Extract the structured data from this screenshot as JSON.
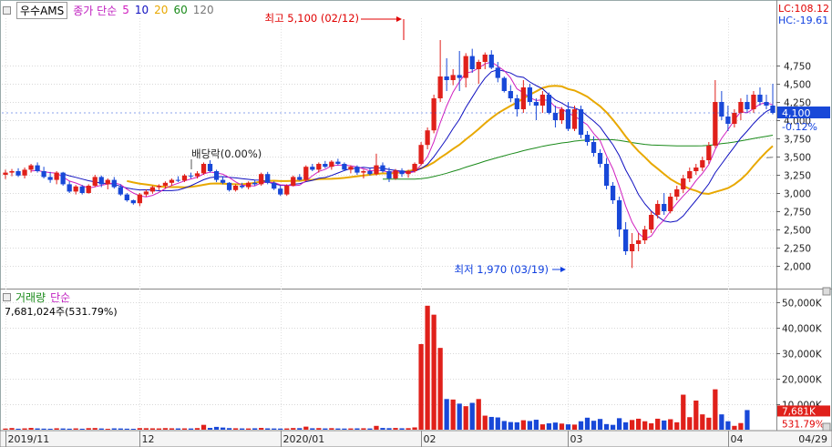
{
  "header": {
    "stock_name": "우수AMS",
    "ma_label": "종가 단순",
    "ma_periods": [
      "5",
      "10",
      "20",
      "60",
      "120"
    ],
    "ma_colors": [
      "#d020c0",
      "#1010c0",
      "#e8a800",
      "#1a8a1a",
      "#777777"
    ]
  },
  "right_info": {
    "lc": "LC:108.12",
    "hc": "HC:-19.61"
  },
  "volume_header": {
    "title": "거래량",
    "ma": "단순",
    "info": "7,681,024주(531.79%)"
  },
  "chart_data": {
    "type": "candlestick",
    "price_axis": {
      "min": 1700,
      "max": 5400,
      "ticks": [
        2000,
        2250,
        2500,
        2750,
        3000,
        3250,
        3500,
        3750,
        4000,
        4250,
        4500,
        4750
      ]
    },
    "price_tick_labels": [
      "2,000",
      "2,250",
      "2,500",
      "2,750",
      "3,000",
      "3,250",
      "3,500",
      "3,750",
      "4,000",
      "4,250",
      "4,500",
      "4,750"
    ],
    "current_price": 4100,
    "current_price_label": "4,100",
    "current_change": "-0.12%",
    "volume_axis": {
      "max": 52000,
      "ticks": [
        10000,
        20000,
        30000,
        40000,
        50000
      ]
    },
    "volume_tick_labels": [
      "10,000K",
      "20,000K",
      "30,000K",
      "40,000K",
      "50,000K"
    ],
    "current_volume_label": "7,681K",
    "current_volume_pct": "531.79%",
    "x_labels": [
      {
        "i": 0,
        "label": "2019/11"
      },
      {
        "i": 21,
        "label": "12"
      },
      {
        "i": 43,
        "label": "2020/01"
      },
      {
        "i": 65,
        "label": "02"
      },
      {
        "i": 88,
        "label": "03"
      },
      {
        "i": 113,
        "label": "04"
      },
      {
        "i": 139,
        "label": "04/29"
      }
    ],
    "annotations": {
      "high": "최고 5,100 (02/12)",
      "low": "최저 1,970 (03/19)",
      "dividend": "배당락(0.00%)"
    },
    "candles": [
      [
        3250,
        3320,
        3190,
        3280
      ],
      [
        3280,
        3330,
        3230,
        3300
      ],
      [
        3300,
        3340,
        3220,
        3240
      ],
      [
        3240,
        3350,
        3200,
        3320
      ],
      [
        3320,
        3400,
        3280,
        3380
      ],
      [
        3380,
        3420,
        3280,
        3300
      ],
      [
        3300,
        3360,
        3200,
        3220
      ],
      [
        3220,
        3290,
        3140,
        3180
      ],
      [
        3180,
        3300,
        3120,
        3280
      ],
      [
        3280,
        3290,
        3100,
        3120
      ],
      [
        3120,
        3160,
        3000,
        3020
      ],
      [
        3020,
        3110,
        2980,
        3090
      ],
      [
        3090,
        3110,
        2980,
        3000
      ],
      [
        3000,
        3120,
        2990,
        3100
      ],
      [
        3100,
        3250,
        3080,
        3220
      ],
      [
        3220,
        3240,
        3080,
        3120
      ],
      [
        3120,
        3200,
        3050,
        3180
      ],
      [
        3180,
        3220,
        3060,
        3080
      ],
      [
        3080,
        3120,
        2960,
        2980
      ],
      [
        2980,
        3000,
        2880,
        2900
      ],
      [
        2900,
        2910,
        2840,
        2860
      ],
      [
        2860,
        3000,
        2820,
        2980
      ],
      [
        2980,
        3050,
        2950,
        3020
      ],
      [
        3020,
        3100,
        2990,
        3080
      ],
      [
        3080,
        3120,
        3040,
        3100
      ],
      [
        3100,
        3160,
        3060,
        3140
      ],
      [
        3140,
        3200,
        3100,
        3180
      ],
      [
        3180,
        3230,
        3150,
        3170
      ],
      [
        3170,
        3260,
        3150,
        3240
      ],
      [
        3240,
        3280,
        3200,
        3230
      ],
      [
        3230,
        3300,
        3200,
        3270
      ],
      [
        3270,
        3420,
        3250,
        3400
      ],
      [
        3400,
        3450,
        3280,
        3300
      ],
      [
        3300,
        3320,
        3150,
        3180
      ],
      [
        3180,
        3230,
        3120,
        3140
      ],
      [
        3140,
        3150,
        3020,
        3040
      ],
      [
        3040,
        3120,
        3020,
        3100
      ],
      [
        3100,
        3140,
        3060,
        3080
      ],
      [
        3080,
        3160,
        3050,
        3140
      ],
      [
        3140,
        3180,
        3100,
        3120
      ],
      [
        3120,
        3280,
        3100,
        3260
      ],
      [
        3260,
        3290,
        3120,
        3140
      ],
      [
        3140,
        3160,
        3040,
        3060
      ],
      [
        3060,
        3100,
        2960,
        2980
      ],
      [
        2980,
        3120,
        2960,
        3100
      ],
      [
        3100,
        3240,
        3090,
        3220
      ],
      [
        3220,
        3260,
        3170,
        3180
      ],
      [
        3180,
        3380,
        3160,
        3360
      ],
      [
        3360,
        3400,
        3300,
        3320
      ],
      [
        3320,
        3420,
        3280,
        3400
      ],
      [
        3400,
        3440,
        3340,
        3360
      ],
      [
        3360,
        3450,
        3320,
        3430
      ],
      [
        3430,
        3470,
        3380,
        3400
      ],
      [
        3400,
        3420,
        3300,
        3320
      ],
      [
        3320,
        3380,
        3270,
        3360
      ],
      [
        3360,
        3380,
        3250,
        3280
      ],
      [
        3280,
        3320,
        3200,
        3300
      ],
      [
        3300,
        3340,
        3240,
        3260
      ],
      [
        3260,
        3540,
        3240,
        3380
      ],
      [
        3380,
        3420,
        3280,
        3300
      ],
      [
        3300,
        3350,
        3150,
        3200
      ],
      [
        3200,
        3330,
        3180,
        3310
      ],
      [
        3310,
        3340,
        3220,
        3260
      ],
      [
        3260,
        3320,
        3210,
        3300
      ],
      [
        3300,
        3420,
        3280,
        3400
      ],
      [
        3400,
        3700,
        3380,
        3660
      ],
      [
        3660,
        3900,
        3600,
        3860
      ],
      [
        3860,
        4350,
        3820,
        4300
      ],
      [
        4300,
        5100,
        4250,
        4600
      ],
      [
        4600,
        4850,
        4400,
        4550
      ],
      [
        4550,
        4700,
        4480,
        4620
      ],
      [
        4620,
        4950,
        4400,
        4580
      ],
      [
        4580,
        4920,
        4450,
        4880
      ],
      [
        4880,
        4980,
        4650,
        4700
      ],
      [
        4700,
        4830,
        4500,
        4800
      ],
      [
        4800,
        4930,
        4700,
        4900
      ],
      [
        4900,
        4960,
        4700,
        4720
      ],
      [
        4720,
        4800,
        4520,
        4580
      ],
      [
        4580,
        4600,
        4380,
        4400
      ],
      [
        4400,
        4480,
        4250,
        4300
      ],
      [
        4300,
        4350,
        4050,
        4150
      ],
      [
        4150,
        4550,
        4100,
        4450
      ],
      [
        4450,
        4500,
        4200,
        4250
      ],
      [
        4250,
        4300,
        4000,
        4200
      ],
      [
        4200,
        4400,
        4100,
        4350
      ],
      [
        4350,
        4380,
        4080,
        4100
      ],
      [
        4100,
        4200,
        3900,
        4000
      ],
      [
        4000,
        4180,
        3950,
        4150
      ],
      [
        4150,
        4250,
        3850,
        3880
      ],
      [
        3880,
        4200,
        3850,
        4150
      ],
      [
        4150,
        4200,
        3750,
        3800
      ],
      [
        3800,
        3850,
        3650,
        3700
      ],
      [
        3700,
        3780,
        3500,
        3550
      ],
      [
        3550,
        3600,
        3350,
        3400
      ],
      [
        3400,
        3480,
        3050,
        3100
      ],
      [
        3100,
        3150,
        2850,
        2900
      ],
      [
        2900,
        2950,
        2400,
        2500
      ],
      [
        2500,
        2600,
        2150,
        2200
      ],
      [
        2200,
        2450,
        1970,
        2300
      ],
      [
        2300,
        2450,
        2200,
        2350
      ],
      [
        2350,
        2550,
        2300,
        2500
      ],
      [
        2500,
        2750,
        2450,
        2700
      ],
      [
        2700,
        2900,
        2650,
        2850
      ],
      [
        2850,
        3000,
        2700,
        2750
      ],
      [
        2750,
        3000,
        2720,
        2950
      ],
      [
        2950,
        3100,
        2900,
        3050
      ],
      [
        3050,
        3250,
        3000,
        3200
      ],
      [
        3200,
        3350,
        3150,
        3300
      ],
      [
        3300,
        3400,
        3250,
        3350
      ],
      [
        3350,
        3500,
        3300,
        3450
      ],
      [
        3450,
        3700,
        3400,
        3650
      ],
      [
        3650,
        4550,
        3620,
        4250
      ],
      [
        4250,
        4400,
        4000,
        4050
      ],
      [
        4050,
        4200,
        3850,
        3950
      ],
      [
        3950,
        4150,
        3900,
        4100
      ],
      [
        4100,
        4300,
        4000,
        4250
      ],
      [
        4250,
        4350,
        4100,
        4150
      ],
      [
        4150,
        4400,
        4100,
        4350
      ],
      [
        4350,
        4450,
        4200,
        4250
      ],
      [
        4250,
        4350,
        4150,
        4200
      ],
      [
        4200,
        4500,
        4080,
        4100
      ]
    ],
    "volumes": [
      450,
      650,
      380,
      520,
      700,
      500,
      420,
      380,
      560,
      480,
      400,
      520,
      380,
      610,
      650,
      480,
      350,
      520,
      480,
      400,
      350,
      620,
      590,
      540,
      500,
      620,
      550,
      500,
      520,
      480,
      630,
      1900,
      700,
      1100,
      850,
      620,
      560,
      500,
      490,
      550,
      700,
      520,
      480,
      450,
      500,
      650,
      600,
      1200,
      550,
      630,
      500,
      600,
      480,
      450,
      500,
      520,
      560,
      480,
      1500,
      680,
      600,
      680,
      550,
      600,
      900,
      33500,
      48500,
      45000,
      32000,
      12000,
      11800,
      10200,
      9200,
      10500,
      12000,
      5500,
      5000,
      4800,
      3400,
      3000,
      2900,
      3700,
      3400,
      3900,
      2100,
      2500,
      2800,
      2400,
      2100,
      2000,
      3300,
      4700,
      3500,
      4200,
      2200,
      1900,
      4500,
      2900,
      3800,
      4300,
      3300,
      2500,
      4300,
      3600,
      4100,
      2900,
      13700,
      4900,
      11400,
      6000,
      4700,
      15800,
      6000,
      3300,
      1500,
      2600,
      7681
    ]
  }
}
